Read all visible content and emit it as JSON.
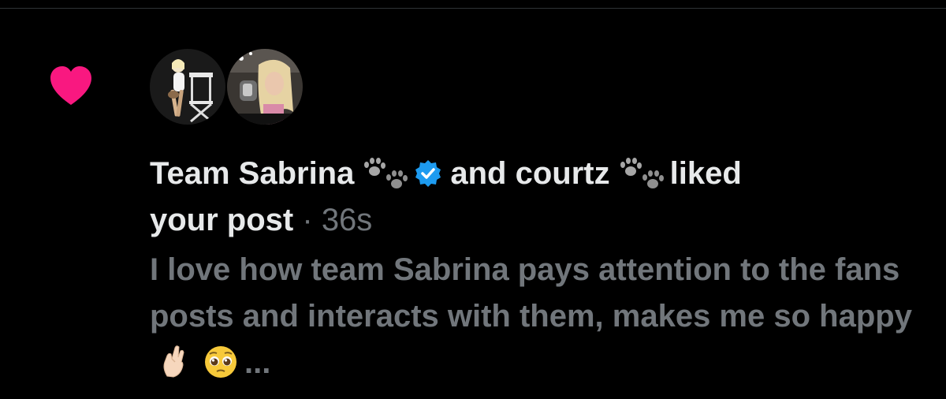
{
  "notification": {
    "type_icon": "heart-icon",
    "accent_color": "#f91880",
    "actors": [
      {
        "name": "Team Sabrina",
        "badge": "paw-prints-emoji",
        "verified": true
      },
      {
        "name": "courtz",
        "badge": "paw-prints-emoji",
        "verified": false
      }
    ],
    "joiner": "and",
    "action": "liked",
    "action_continued": "your post",
    "separator": "·",
    "timestamp": "36s",
    "snippet_text": "I love how team Sabrina pays attention to the fans posts and interacts with them, makes me so happy",
    "snippet_emojis": [
      "crossed-fingers-emoji",
      "pleading-face-emoji"
    ],
    "ellipsis": "..."
  },
  "colors": {
    "background": "#000000",
    "primary_text": "#e7e9ea",
    "secondary_text": "#71767b",
    "verified_blue": "#1d9bf0"
  }
}
